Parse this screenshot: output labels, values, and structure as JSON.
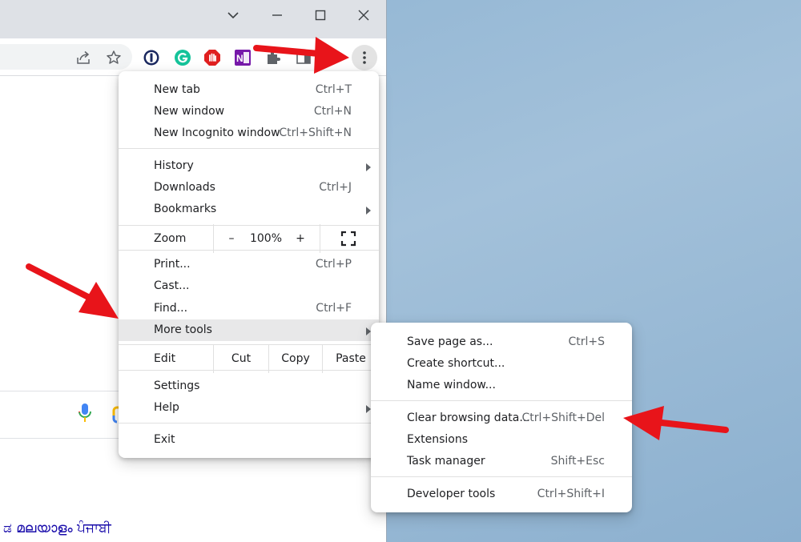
{
  "browser": {
    "scripts_text": "ಡ  മലയാളം  ਪੰਜਾਬੀ"
  },
  "icons": {
    "onenote_label": "N"
  },
  "menu": {
    "sections": {
      "tabs": [
        {
          "label": "New tab",
          "shortcut": "Ctrl+T"
        },
        {
          "label": "New window",
          "shortcut": "Ctrl+N"
        },
        {
          "label": "New Incognito window",
          "shortcut": "Ctrl+Shift+N"
        }
      ],
      "history": [
        {
          "label": "History",
          "shortcut": ""
        },
        {
          "label": "Downloads",
          "shortcut": "Ctrl+J"
        },
        {
          "label": "Bookmarks",
          "shortcut": ""
        }
      ],
      "tools": [
        {
          "label": "Print...",
          "shortcut": "Ctrl+P"
        },
        {
          "label": "Cast...",
          "shortcut": ""
        },
        {
          "label": "Find...",
          "shortcut": "Ctrl+F"
        },
        {
          "label": "More tools",
          "shortcut": ""
        }
      ],
      "settings": [
        {
          "label": "Settings"
        },
        {
          "label": "Help"
        }
      ],
      "exit": {
        "label": "Exit"
      }
    },
    "zoom": {
      "label": "Zoom",
      "minus": "–",
      "value": "100%",
      "plus": "+"
    },
    "edit": {
      "label": "Edit",
      "cut": "Cut",
      "copy": "Copy",
      "paste": "Paste"
    }
  },
  "submenu": {
    "items": [
      {
        "label": "Save page as...",
        "shortcut": "Ctrl+S"
      },
      {
        "label": "Create shortcut...",
        "shortcut": ""
      },
      {
        "label": "Name window...",
        "shortcut": ""
      },
      {
        "label": "Clear browsing data...",
        "shortcut": "Ctrl+Shift+Del"
      },
      {
        "label": "Extensions",
        "shortcut": ""
      },
      {
        "label": "Task manager",
        "shortcut": "Shift+Esc"
      },
      {
        "label": "Developer tools",
        "shortcut": "Ctrl+Shift+I"
      }
    ]
  },
  "colors": {
    "annotation_arrow": "#e8141a",
    "menu_highlight": "#e8e8e9",
    "desktop": "#9dbdd8"
  }
}
